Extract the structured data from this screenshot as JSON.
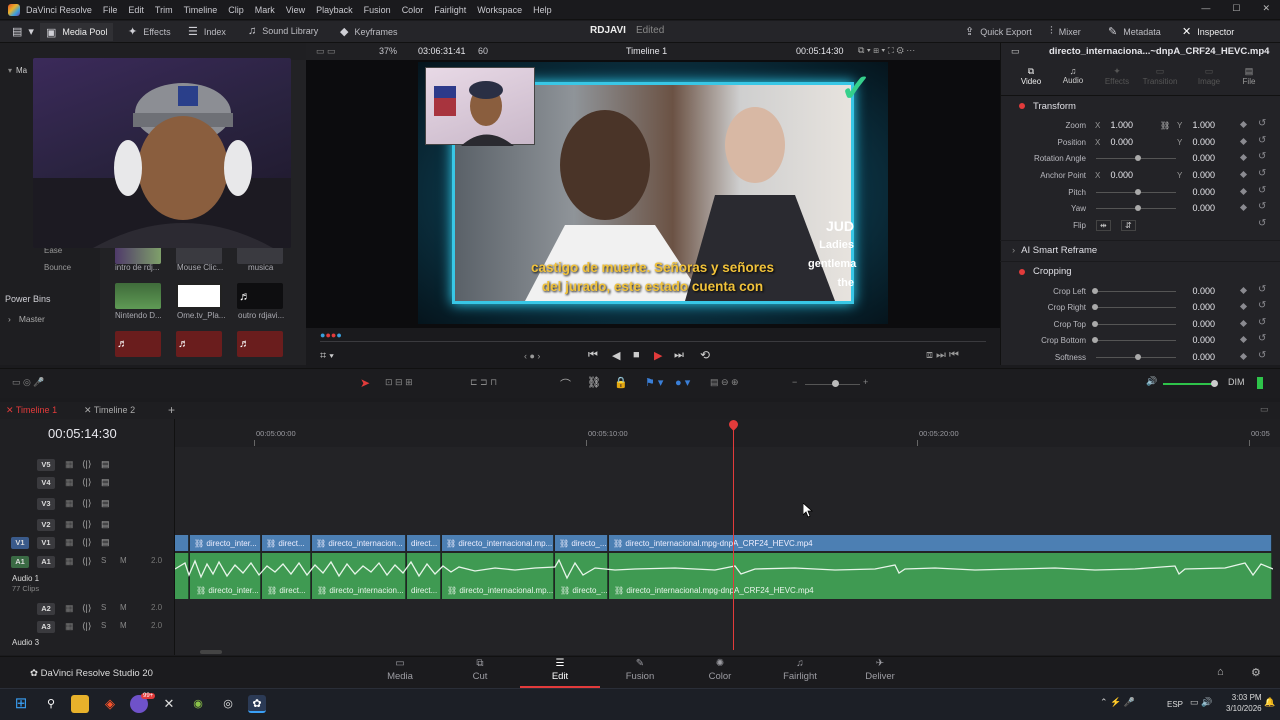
{
  "menubar": {
    "app_name": "DaVinci Resolve",
    "items": [
      "File",
      "Edit",
      "Trim",
      "Timeline",
      "Clip",
      "Mark",
      "View",
      "Playback",
      "Fusion",
      "Color",
      "Fairlight",
      "Workspace",
      "Help"
    ]
  },
  "toolbar": {
    "media_pool": "Media Pool",
    "effects": "Effects",
    "index": "Index",
    "sound_library": "Sound Library",
    "keyframes": "Keyframes",
    "project_name": "RDJAVI",
    "project_status": "Edited",
    "quick_export": "Quick Export",
    "mixer": "Mixer",
    "metadata": "Metadata",
    "inspector": "Inspector"
  },
  "viewer": {
    "zoom": "37%",
    "source_timecode": "03:06:31:41",
    "fps": "60",
    "timeline_name": "Timeline 1",
    "record_timecode": "00:05:14:30",
    "subtitle_line1": "castigo de muerte. Señoras y señores",
    "subtitle_line2": "del jurado, este estado cuenta con",
    "overlay_r1": "JUD",
    "overlay_r2": "Ladies",
    "overlay_r3": "gentlema",
    "overlay_r4": "the"
  },
  "media_pool": {
    "left_labels": [
      "Ma",
      "Ease",
      "Bounce"
    ],
    "power_bins": "Power Bins",
    "master": "Master",
    "thumbs": [
      {
        "label": "intro de rdj..."
      },
      {
        "label": "Mouse Clic..."
      },
      {
        "label": "musica"
      },
      {
        "label": "Nintendo D..."
      },
      {
        "label": "Ome.tv_Pla..."
      },
      {
        "label": "outro rdjavi..."
      }
    ]
  },
  "inspector": {
    "clip_name": "directo_internaciona...~dnpA_CRF24_HEVC.mp4",
    "tabs": [
      "Video",
      "Audio",
      "Effects",
      "Transition",
      "Image",
      "File"
    ],
    "transform": "Transform",
    "zoom_label": "Zoom",
    "zoom_x": "1.000",
    "zoom_y": "1.000",
    "position_label": "Position",
    "pos_x": "0.000",
    "pos_y": "0.000",
    "rotation_label": "Rotation Angle",
    "rotation": "0.000",
    "anchor_label": "Anchor Point",
    "anchor_x": "0.000",
    "anchor_y": "0.000",
    "pitch_label": "Pitch",
    "pitch": "0.000",
    "yaw_label": "Yaw",
    "yaw": "0.000",
    "flip_label": "Flip",
    "smart_reframe": "AI Smart Reframe",
    "cropping": "Cropping",
    "crop_left_label": "Crop Left",
    "crop_left": "0.000",
    "crop_right_label": "Crop Right",
    "crop_right": "0.000",
    "crop_top_label": "Crop Top",
    "crop_top": "0.000",
    "crop_bottom_label": "Crop Bottom",
    "crop_bottom": "0.000",
    "softness_label": "Softness",
    "softness": "0.000",
    "x": "X",
    "y": "Y"
  },
  "timeline": {
    "tab1": "Timeline 1",
    "tab2": "Timeline 2",
    "timecode": "00:05:14:30",
    "ruler": [
      "00:05:00:00",
      "00:05:10:00",
      "00:05:20:00",
      "00:05"
    ],
    "dim": "DIM",
    "tracks": {
      "v5": "V5",
      "v4": "V4",
      "v3": "V3",
      "v2": "V2",
      "v1": "V1",
      "v1src": "V1",
      "a1": "A1",
      "a1src": "A1",
      "a2": "A2",
      "a3": "A3",
      "audio1": "Audio 1",
      "clips": "77 Clips",
      "audio3": "Audio 3",
      "s": "S",
      "m": "M",
      "vol": "2.0"
    },
    "clips": [
      "directo_inter...",
      "direct...",
      "directo_internacion...",
      "direct...",
      "directo_internacional.mp...",
      "directo_...",
      "directo_internacional.mpg-dnpA_CRF24_HEVC.mp4"
    ]
  },
  "pages": {
    "brand": "DaVinci Resolve Studio 20",
    "media": "Media",
    "cut": "Cut",
    "edit": "Edit",
    "fusion": "Fusion",
    "color": "Color",
    "fairlight": "Fairlight",
    "deliver": "Deliver"
  },
  "taskbar": {
    "lang": "ESP",
    "time": "3:03 PM",
    "date": "3/10/2026",
    "badge": "99+"
  },
  "colors": {
    "accent": "#e23b3b",
    "video_clip": "#4c7fb3",
    "audio_clip": "#3f9a52",
    "frame_glow": "#38c7e6"
  }
}
